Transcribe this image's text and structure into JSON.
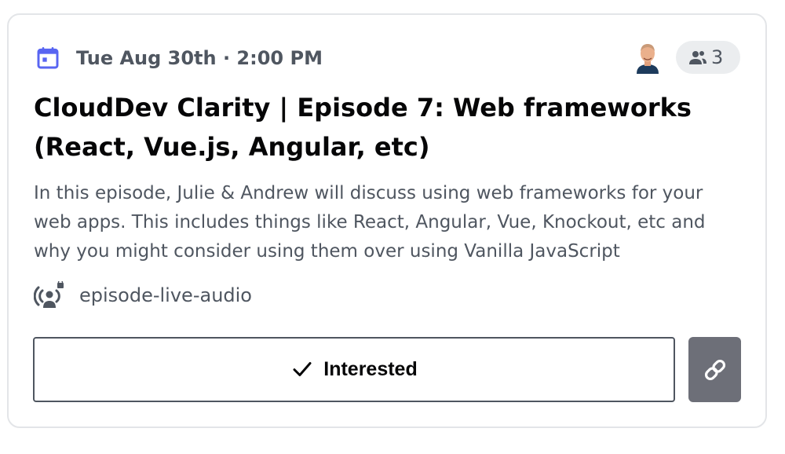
{
  "event": {
    "date_time": "Tue Aug 30th · 2:00 PM",
    "interested_count": "3",
    "title": "CloudDev Clarity | Episode 7: Web frameworks (React, Vue.js, Angular, etc)",
    "description": "In this episode, Julie & Andrew will discuss using web frameworks for your web apps. This includes things like React, Angular, Vue, Knockout, etc and why you might consider using them over using Vanilla JavaScript",
    "channel": "episode-live-audio"
  },
  "actions": {
    "interested_label": "Interested"
  },
  "icons": {
    "calendar": "calendar-icon",
    "people": "people-icon",
    "channel": "stage-channel-icon",
    "check": "check-icon",
    "link": "link-icon"
  },
  "colors": {
    "accent": "#5865f2",
    "text_muted": "#4f5660",
    "text_strong": "#060607",
    "pill_bg": "#ebedef",
    "link_button_bg": "#6d6f78"
  }
}
